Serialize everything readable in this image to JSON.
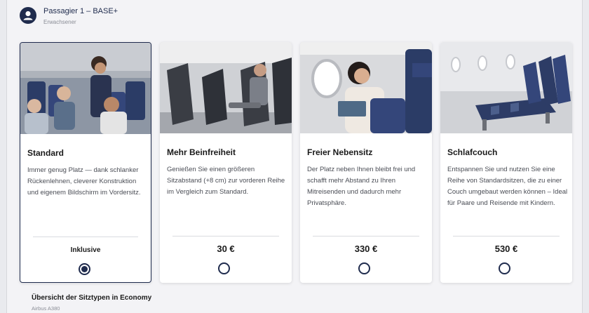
{
  "passenger": {
    "title": "Passagier 1 – BASE+",
    "subtitle": "Erwachsener",
    "icon": "user-avatar-icon"
  },
  "options": [
    {
      "id": "standard",
      "title": "Standard",
      "description": "Immer genug Platz — dank schlanker Rückenlehnen, cleverer Konstruktion und eigenem Bildschirm im Vordersitz.",
      "price": "Inklusive",
      "selected": true
    },
    {
      "id": "mehr-beinfreiheit",
      "title": "Mehr Beinfreiheit",
      "description": "Genießen Sie einen größeren Sitzabstand (+8 cm) zur vorderen Reihe im Vergleich zum Standard.",
      "price": "30 €",
      "selected": false
    },
    {
      "id": "freier-nebensitz",
      "title": "Freier Nebensitz",
      "description": "Der Platz neben Ihnen bleibt frei und schafft mehr Abstand zu Ihren Mitreisenden und dadurch mehr Privatsphäre.",
      "price": "330 €",
      "selected": false
    },
    {
      "id": "schlafcouch",
      "title": "Schlafcouch",
      "description": "Entspannen Sie und nutzen Sie eine Reihe von Standardsitzen, die zu einer Couch umgebaut werden können – Ideal für Paare und Reisende mit Kindern.",
      "price": "530 €",
      "selected": false
    }
  ],
  "overview": {
    "title": "Übersicht der Sitztypen in Economy",
    "aircraft": "Airbus A380"
  },
  "colors": {
    "accent": "#1f2b4d",
    "background": "#f3f3f6",
    "card": "#ffffff"
  }
}
